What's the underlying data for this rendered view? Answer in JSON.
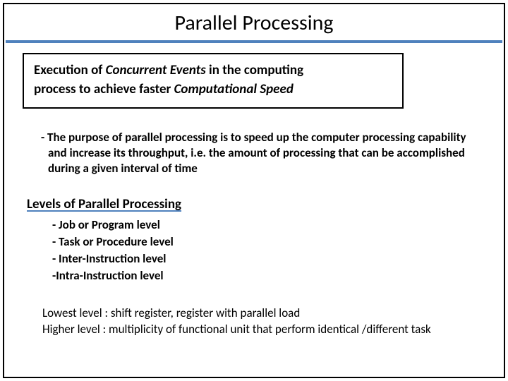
{
  "title": "Parallel Processing",
  "definition": {
    "line1_prefix": "Execution of ",
    "line1_emph": "Concurrent Events",
    "line1_suffix": "  in the computing",
    "line2_prefix": "process to achieve faster ",
    "line2_emph": "Computational Speed"
  },
  "purpose": "- The purpose of parallel processing is to speed up the computer processing capability and increase its throughput, i.e. the amount of processing that can be accomplished during a given interval of time",
  "levels_heading": "Levels of Parallel Processing",
  "levels": {
    "item1": "- Job or Program level",
    "item2": "- Task or Procedure level",
    "item3": "- Inter-Instruction level",
    "item4": "-Intra-Instruction level"
  },
  "footer": {
    "line1": "Lowest level : shift register, register with parallel load",
    "line2": "Higher level : multiplicity of functional unit that perform identical /different task"
  }
}
